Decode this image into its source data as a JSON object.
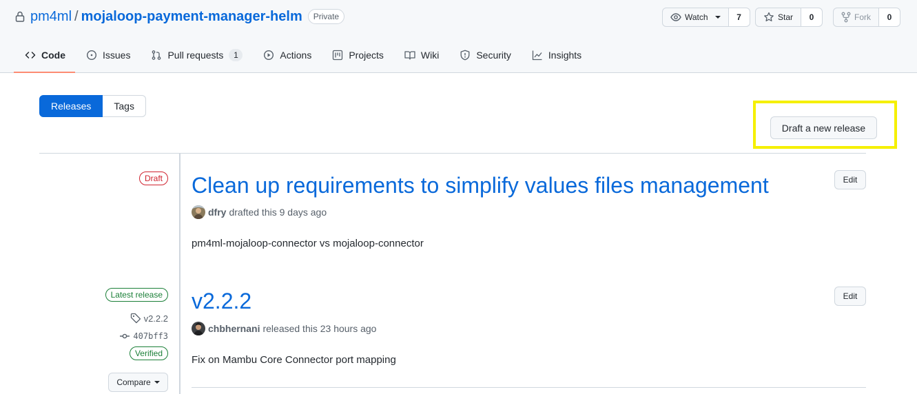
{
  "repo": {
    "owner": "pm4ml",
    "separator": "/",
    "name": "mojaloop-payment-manager-helm",
    "visibility": "Private"
  },
  "social": {
    "watch": {
      "label": "Watch",
      "count": "7"
    },
    "star": {
      "label": "Star",
      "count": "0"
    },
    "fork": {
      "label": "Fork",
      "count": "0"
    }
  },
  "nav": {
    "code": "Code",
    "issues": "Issues",
    "pull_requests": "Pull requests",
    "pull_requests_count": "1",
    "actions": "Actions",
    "projects": "Projects",
    "wiki": "Wiki",
    "security": "Security",
    "insights": "Insights"
  },
  "subnav": {
    "releases": "Releases",
    "tags": "Tags"
  },
  "draft_button": "Draft a new release",
  "releases": [
    {
      "state_label": "Draft",
      "title": "Clean up requirements to simplify values files management",
      "author": "dfry",
      "action_text": "drafted this 9 days ago",
      "body": "pm4ml-mojaloop-connector vs mojaloop-connector",
      "edit_label": "Edit"
    },
    {
      "state_label": "Latest release",
      "tag": "v2.2.2",
      "commit": "407bff3",
      "verified": "Verified",
      "compare": "Compare",
      "title": "v2.2.2",
      "author": "chbhernani",
      "action_text": "released this 23 hours ago",
      "body": "Fix on Mambu Core Connector port mapping",
      "edit_label": "Edit"
    }
  ],
  "colors": {
    "accent": "#0969da",
    "draft": "#cf222e",
    "latest": "#1a7f37",
    "highlight": "#f5f000",
    "selected_tab_underline": "#fd8c73"
  }
}
